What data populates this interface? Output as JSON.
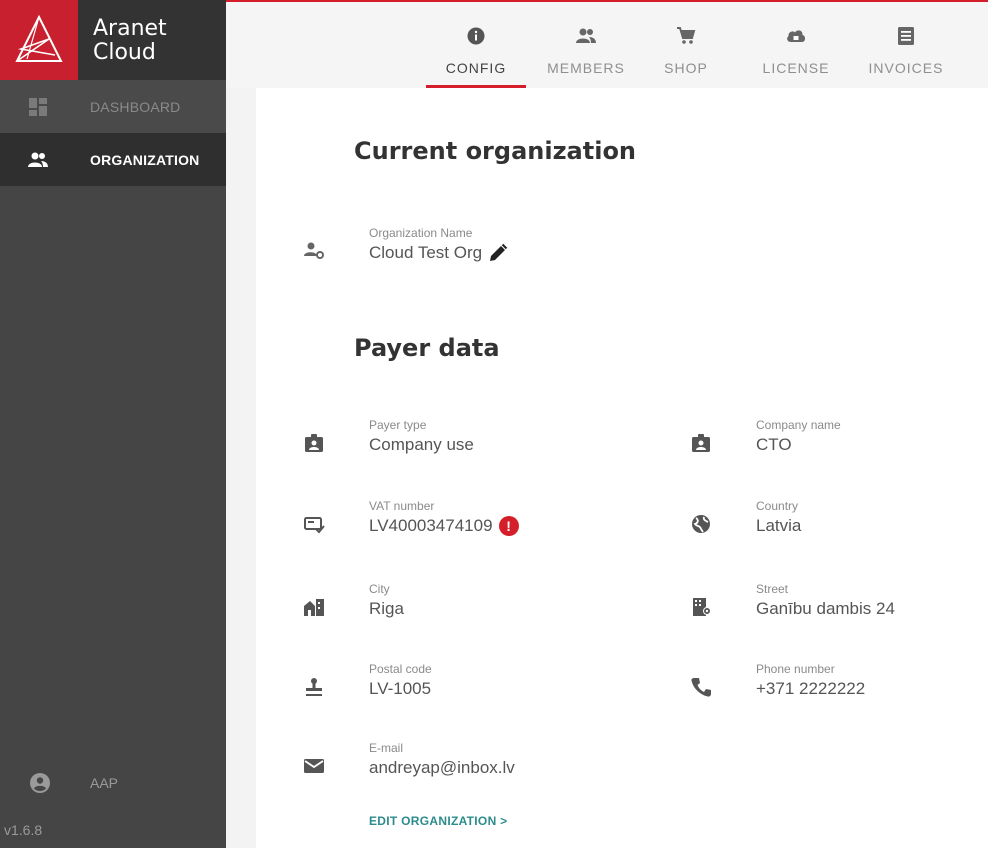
{
  "brand": {
    "line1": "Aranet",
    "line2": "Cloud"
  },
  "sidebar": {
    "items": [
      {
        "label": "DASHBOARD",
        "icon": "dashboard-icon"
      },
      {
        "label": "ORGANIZATION",
        "icon": "people-icon"
      }
    ],
    "user": {
      "label": "AAP",
      "icon": "account-circle-icon"
    },
    "version": "v1.6.8"
  },
  "tabs": [
    {
      "label": "CONFIG",
      "icon": "info-icon",
      "active": true
    },
    {
      "label": "MEMBERS",
      "icon": "people-icon"
    },
    {
      "label": "SHOP",
      "icon": "cart-icon"
    },
    {
      "label": "LICENSE",
      "icon": "cloud-icon"
    },
    {
      "label": "INVOICES",
      "icon": "list-icon"
    }
  ],
  "current_org": {
    "title": "Current organization",
    "name_label": "Organization Name",
    "name_value": "Cloud Test Org"
  },
  "payer": {
    "title": "Payer data",
    "payer_type": {
      "label": "Payer type",
      "value": "Company use"
    },
    "company_name": {
      "label": "Company name",
      "value": "CTO"
    },
    "vat": {
      "label": "VAT number",
      "value": "LV40003474109"
    },
    "country": {
      "label": "Country",
      "value": "Latvia"
    },
    "city": {
      "label": "City",
      "value": "Riga"
    },
    "street": {
      "label": "Street",
      "value": "Ganību dambis 24"
    },
    "postal": {
      "label": "Postal code",
      "value": "LV-1005"
    },
    "phone": {
      "label": "Phone number",
      "value": "+371 2222222"
    },
    "email": {
      "label": "E-mail",
      "value": "andreyap@inbox.lv"
    }
  },
  "edit_link": "EDIT ORGANIZATION >",
  "colors": {
    "accent": "#d41f2a",
    "sidebar": "#454545",
    "link": "#2c8c8c"
  }
}
